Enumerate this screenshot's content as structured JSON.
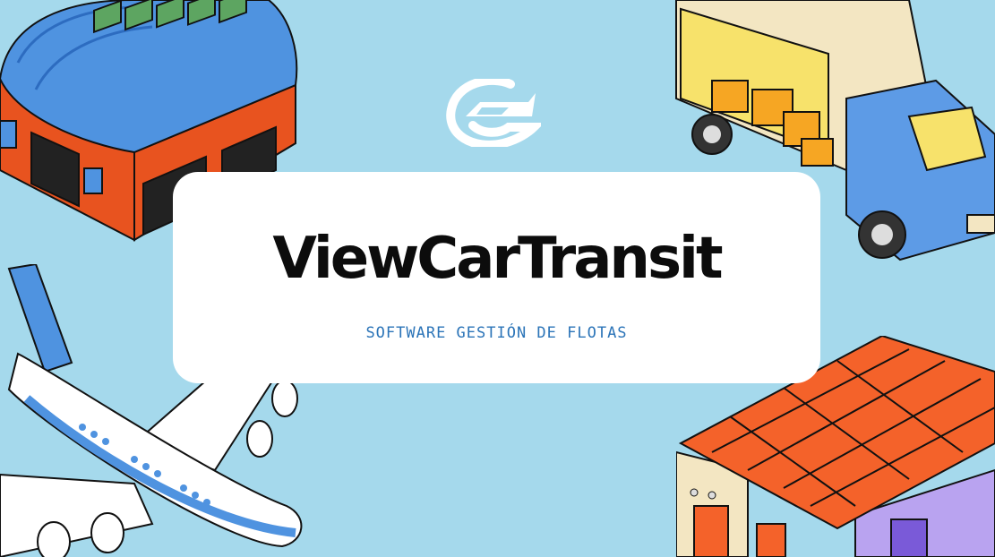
{
  "brand": {
    "name": "ViewCarTransit",
    "tagline": "SOFTWARE GESTIÓN DE FLOTAS"
  },
  "colors": {
    "background": "#a5d9ec",
    "card": "#ffffff",
    "title": "#0c0c0c",
    "tagline": "#2b74b8",
    "roof_blue": "#4f93e0",
    "brick_orange": "#e8531f",
    "truck_blue": "#5d9be6",
    "box_orange": "#f6a623"
  },
  "icons": [
    "logo-icon",
    "hangar-icon",
    "truck-icon",
    "airplane-icon",
    "warehouse-icon"
  ]
}
